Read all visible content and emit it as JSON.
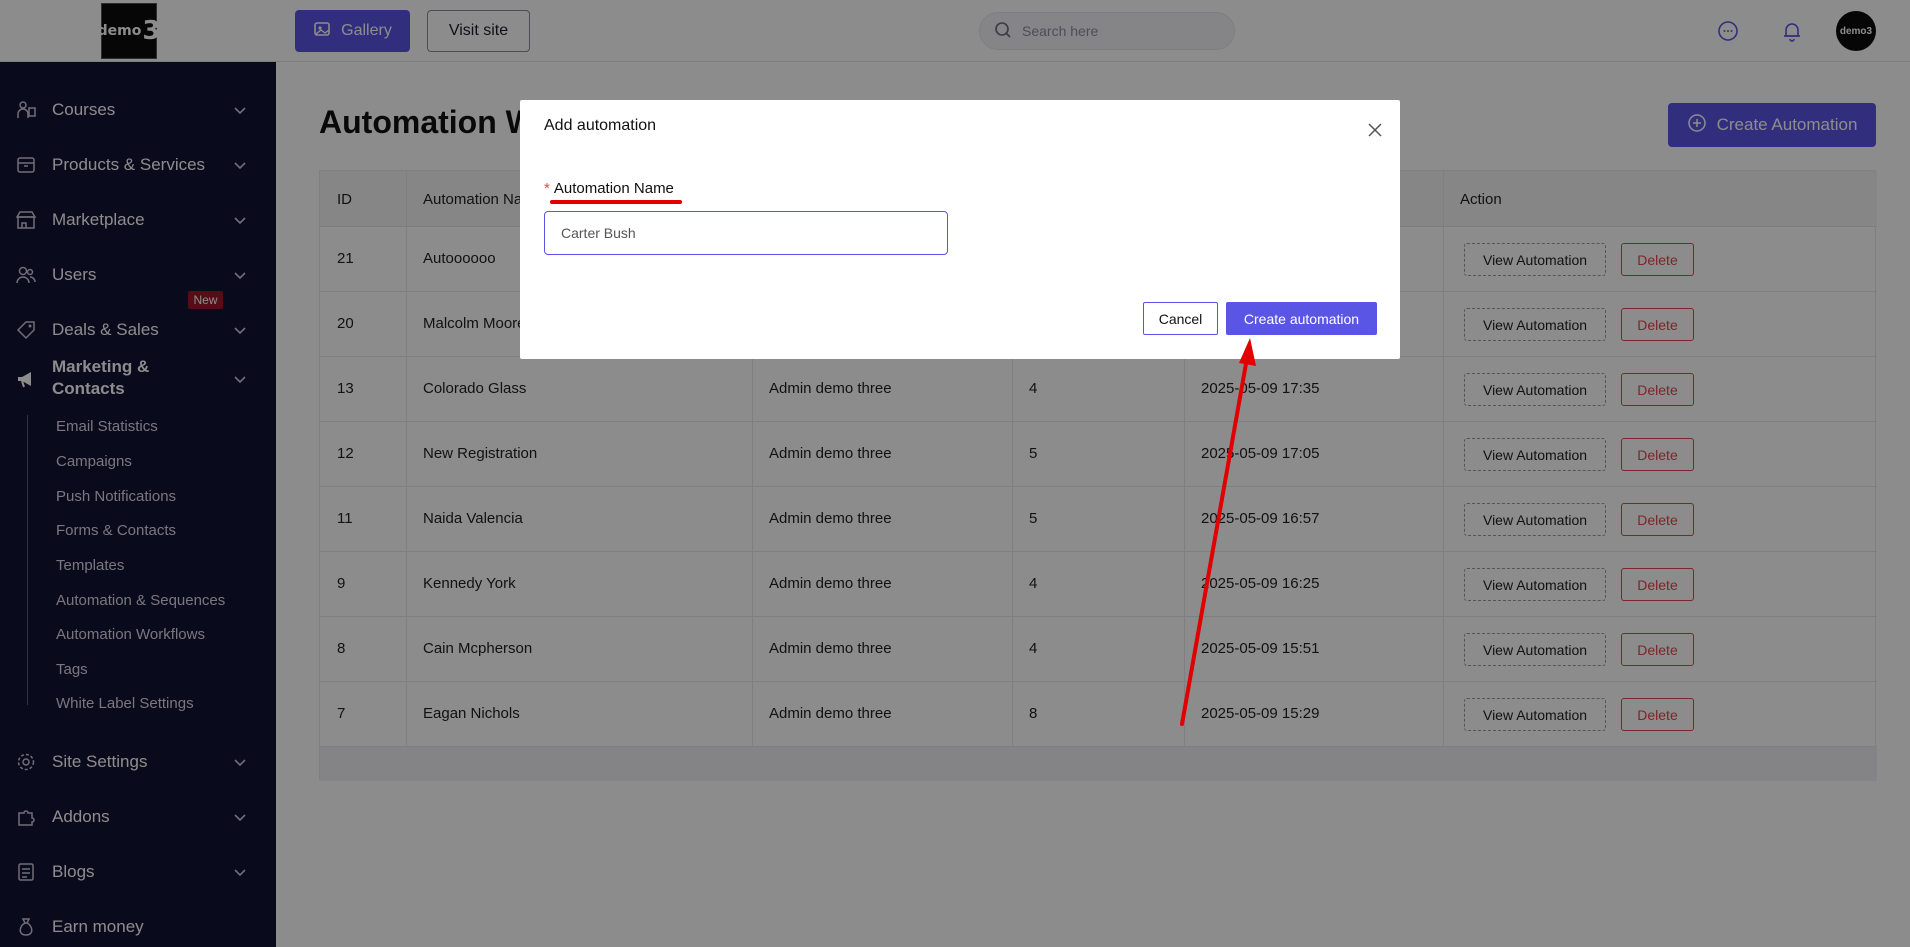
{
  "header": {
    "logo_text": "demo",
    "logo_num": "3",
    "gallery_label": "Gallery",
    "visit_label": "Visit site",
    "search_placeholder": "Search here",
    "avatar_text": "demo3"
  },
  "sidebar": {
    "items": [
      {
        "label": "Courses",
        "icon": "graduation-icon"
      },
      {
        "label": "Products & Services",
        "icon": "box-icon"
      },
      {
        "label": "Marketplace",
        "icon": "store-icon"
      },
      {
        "label": "Users",
        "icon": "users-icon"
      },
      {
        "label": "Deals & Sales",
        "icon": "tag-icon"
      },
      {
        "label_line1": "Marketing &",
        "label_line2": "Contacts",
        "icon": "megaphone-icon",
        "badge": "New"
      },
      {
        "label": "Site Settings",
        "icon": "gear-icon"
      },
      {
        "label": "Addons",
        "icon": "puzzle-icon"
      },
      {
        "label": "Blogs",
        "icon": "blog-icon"
      },
      {
        "label": "Earn money",
        "icon": "money-bag-icon"
      }
    ],
    "subitems": [
      "Email Statistics",
      "Campaigns",
      "Push Notifications",
      "Forms & Contacts",
      "Templates",
      "Automation & Sequences",
      "Automation Workflows",
      "Tags",
      "White Label Settings"
    ]
  },
  "page": {
    "title": "Automation Workflows",
    "create_label": "Create Automation"
  },
  "table": {
    "columns": [
      "ID",
      "Automation Name",
      "",
      "",
      "",
      "Action"
    ],
    "rows": [
      {
        "id": "21",
        "name": "Autoooooo",
        "owner": "",
        "count": "",
        "date": ""
      },
      {
        "id": "20",
        "name": "Malcolm Moore",
        "owner": "",
        "count": "",
        "date": ""
      },
      {
        "id": "13",
        "name": "Colorado Glass",
        "owner": "Admin demo three",
        "count": "4",
        "date": "2025-05-09 17:35"
      },
      {
        "id": "12",
        "name": "New Registration",
        "owner": "Admin demo three",
        "count": "5",
        "date": "2025-05-09 17:05"
      },
      {
        "id": "11",
        "name": "Naida Valencia",
        "owner": "Admin demo three",
        "count": "5",
        "date": "2025-05-09 16:57"
      },
      {
        "id": "9",
        "name": "Kennedy York",
        "owner": "Admin demo three",
        "count": "4",
        "date": "2025-05-09 16:25"
      },
      {
        "id": "8",
        "name": "Cain Mcpherson",
        "owner": "Admin demo three",
        "count": "4",
        "date": "2025-05-09 15:51"
      },
      {
        "id": "7",
        "name": "Eagan Nichols",
        "owner": "Admin demo three",
        "count": "8",
        "date": "2025-05-09 15:29"
      }
    ],
    "view_label": "View Automation",
    "delete_label": "Delete"
  },
  "modal": {
    "title": "Add automation",
    "field_required": "*",
    "field_label": "Automation Name",
    "field_value": "Carter Bush",
    "cancel_label": "Cancel",
    "submit_label": "Create automation"
  },
  "colors": {
    "accent": "#5b55e6",
    "sidebar_bg": "#111436",
    "danger": "#e0464e",
    "annotation": "#e00000"
  }
}
